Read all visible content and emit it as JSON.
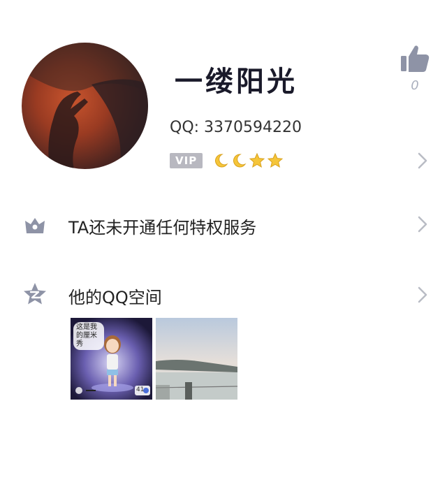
{
  "profile": {
    "nickname": "一缕阳光",
    "qq_label": "QQ: 3370594220",
    "vip_label": "VIP",
    "level_icons": [
      "moon",
      "moon",
      "star",
      "star"
    ],
    "like_count": "0"
  },
  "rows": {
    "privilege_text": "TA还未开通任何特权服务",
    "qzone_text": "他的QQ空间"
  },
  "qzone": {
    "thumb1_caption": "这是我的厘米秀",
    "thumb1_badge": "41"
  },
  "colors": {
    "icon_gray": "#8e93a6",
    "chevron": "#b9bcc5",
    "vip_bg": "#b8b8c0"
  }
}
